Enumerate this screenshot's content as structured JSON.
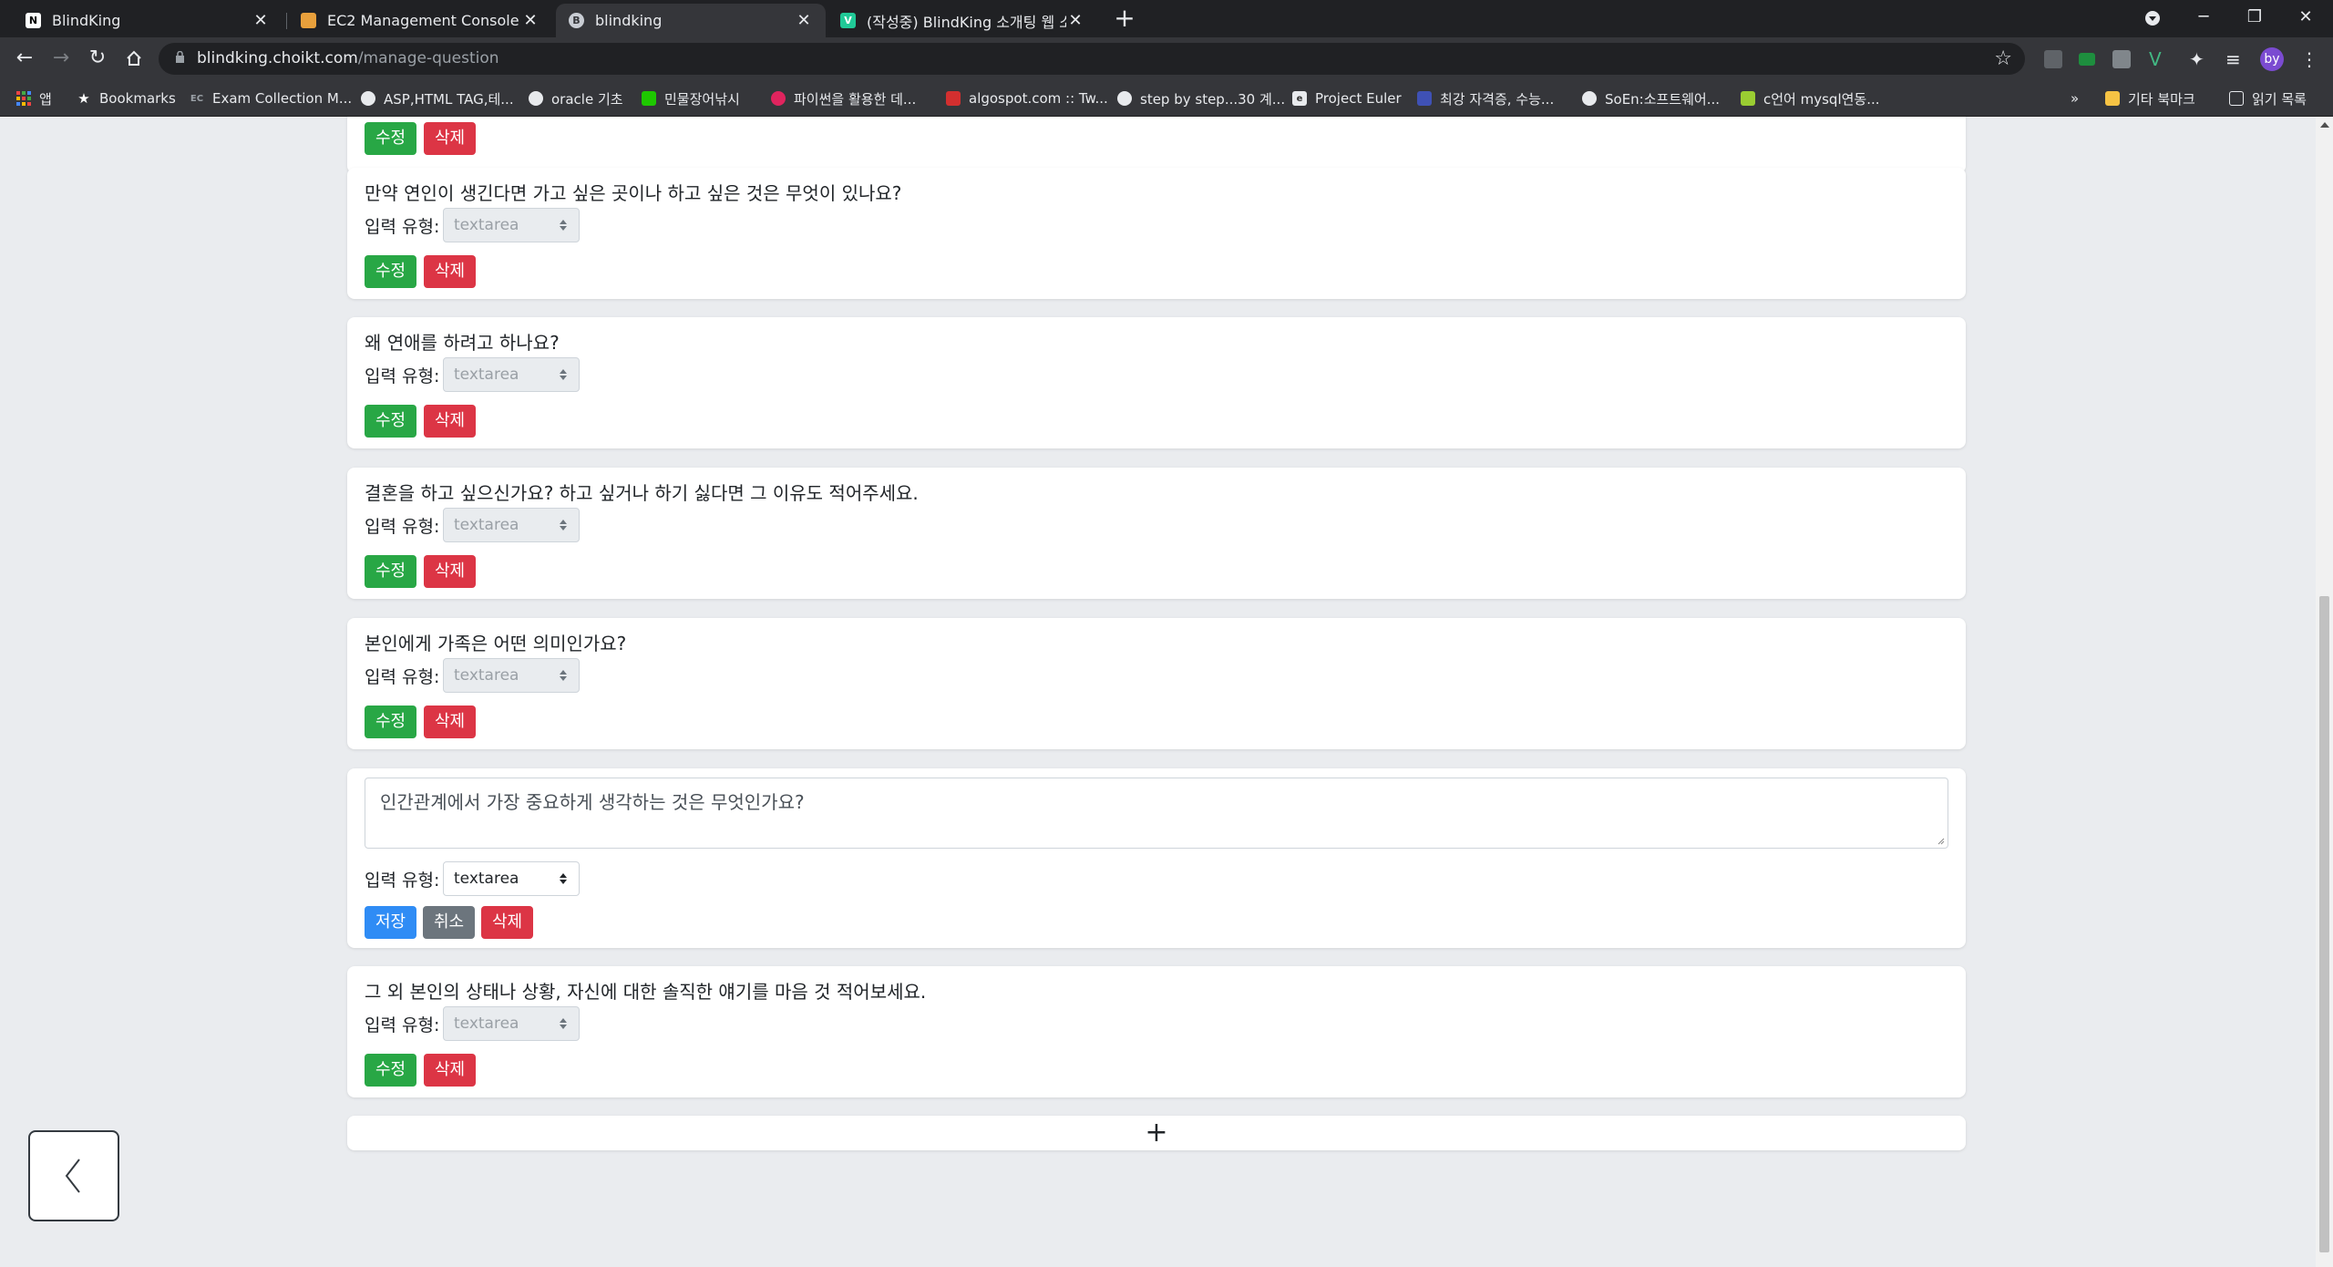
{
  "tabs": [
    {
      "title": "BlindKing",
      "icon": "notion-icon"
    },
    {
      "title": "EC2 Management Console",
      "icon": "aws-box-icon"
    },
    {
      "title": "blindking",
      "icon": "b-logo-icon"
    },
    {
      "title": "(작성중) BlindKing 소개팅 웹 소",
      "icon": "v-doc-icon"
    }
  ],
  "address": {
    "host": "blindking.choikt.com",
    "path": "/manage-question"
  },
  "bookmarks": [
    {
      "label": "앱"
    },
    {
      "label": "Bookmarks"
    },
    {
      "label": "Exam Collection M..."
    },
    {
      "label": "ASP,HTML TAG,테..."
    },
    {
      "label": "oracle 기초"
    },
    {
      "label": "민물장어낚시"
    },
    {
      "label": "파이썬을 활용한 데..."
    },
    {
      "label": "algospot.com :: Tw..."
    },
    {
      "label": "step by step...30 계..."
    },
    {
      "label": "Project Euler"
    },
    {
      "label": "최강 자격증, 수능..."
    },
    {
      "label": "SoEn:소프트웨어..."
    },
    {
      "label": "c언어 mysql연동..."
    },
    {
      "label": "»"
    },
    {
      "label": "기타 북마크"
    },
    {
      "label": "읽기 목록"
    }
  ],
  "labels": {
    "input_type": "입력 유형:",
    "edit": "수정",
    "delete": "삭제",
    "save": "저장",
    "cancel": "취소"
  },
  "questions": [
    {
      "text": "",
      "input_type": ""
    },
    {
      "text": "만약 연인이 생긴다면 가고 싶은 곳이나 하고 싶은 것은 무엇이 있나요?",
      "input_type": "textarea"
    },
    {
      "text": "왜 연애를 하려고 하나요?",
      "input_type": "textarea"
    },
    {
      "text": "결혼을 하고 싶으신가요? 하고 싶거나 하기 싫다면 그 이유도 적어주세요.",
      "input_type": "textarea"
    },
    {
      "text": "본인에게 가족은 어떤 의미인가요?",
      "input_type": "textarea"
    },
    {
      "text": "인간관계에서 가장 중요하게 생각하는 것은 무엇인가요?",
      "input_type": "textarea",
      "editing": true
    },
    {
      "text": "그 외 본인의 상태나 상황, 자신에 대한 솔직한 얘기를 마음 것 적어보세요.",
      "input_type": "textarea"
    }
  ],
  "add_label": "+",
  "colors": {
    "edit": "#28a745",
    "delete": "#dc3545",
    "save": "#2f8cf5",
    "cancel": "#6c757d"
  }
}
